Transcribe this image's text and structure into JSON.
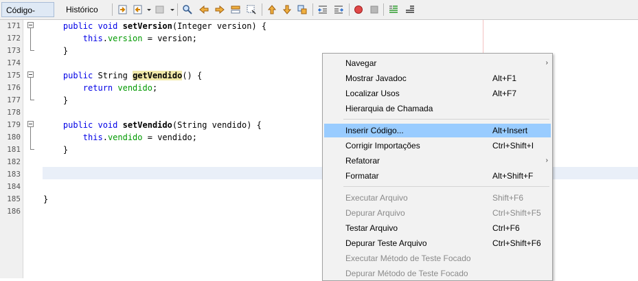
{
  "tabs": {
    "source": "Código-Fonte",
    "history": "Histórico"
  },
  "toolbar_icons": [
    "go-to-last-edit-icon",
    "back-icon",
    "forward-icon",
    "find-icon",
    "find-previous-icon",
    "find-next-icon",
    "find-selection-icon",
    "toggle-highlight-icon",
    "previous-bookmark-icon",
    "next-bookmark-icon",
    "toggle-bookmark-icon",
    "shift-left-icon",
    "shift-right-icon",
    "start-macro-icon",
    "stop-macro-icon",
    "comment-icon",
    "uncomment-icon"
  ],
  "editor": {
    "line_numbers": [
      "171",
      "172",
      "173",
      "174",
      "175",
      "176",
      "177",
      "178",
      "179",
      "180",
      "181",
      "182",
      "183",
      "184",
      "185",
      "186"
    ],
    "current_line": "183",
    "lines": {
      "l171": {
        "kw": "public void ",
        "method": "setVersion",
        "rest": "(Integer version) {"
      },
      "l172": {
        "kw": "this",
        "dot": ".",
        "field": "version",
        "rest": " = version;"
      },
      "l173": "}",
      "l175": {
        "kw": "public ",
        "type": "String ",
        "method": "getVendido",
        "rest": "() {"
      },
      "l176": {
        "kw": "return ",
        "field": "vendido",
        "rest": ";"
      },
      "l177": "}",
      "l179": {
        "kw": "public void ",
        "method": "setVendido",
        "rest": "(String vendido) {"
      },
      "l180": {
        "kw": "this",
        "dot": ".",
        "field": "vendido",
        "rest": " = vendido;"
      },
      "l181": "}",
      "l185": "}"
    }
  },
  "context_menu": {
    "items": [
      {
        "label": "Navegar",
        "shortcut": "",
        "submenu": true,
        "enabled": true
      },
      {
        "label": "Mostrar Javadoc",
        "shortcut": "Alt+F1",
        "enabled": true
      },
      {
        "label": "Localizar Usos",
        "shortcut": "Alt+F7",
        "enabled": true
      },
      {
        "label": "Hierarquia de Chamada",
        "shortcut": "",
        "enabled": true
      },
      {
        "label": "Inserir Código...",
        "shortcut": "Alt+Insert",
        "enabled": true,
        "selected": true
      },
      {
        "label": "Corrigir Importações",
        "shortcut": "Ctrl+Shift+I",
        "enabled": true
      },
      {
        "label": "Refatorar",
        "shortcut": "",
        "submenu": true,
        "enabled": true
      },
      {
        "label": "Formatar",
        "shortcut": "Alt+Shift+F",
        "enabled": true
      },
      {
        "label": "Executar Arquivo",
        "shortcut": "Shift+F6",
        "enabled": false
      },
      {
        "label": "Depurar Arquivo",
        "shortcut": "Ctrl+Shift+F5",
        "enabled": false
      },
      {
        "label": "Testar Arquivo",
        "shortcut": "Ctrl+F6",
        "enabled": true
      },
      {
        "label": "Depurar Teste Arquivo",
        "shortcut": "Ctrl+Shift+F6",
        "enabled": true
      },
      {
        "label": "Executar Método de Teste Focado",
        "shortcut": "",
        "enabled": false
      },
      {
        "label": "Depurar Método de Teste Focado",
        "shortcut": "",
        "enabled": false
      }
    ],
    "submenu_arrow": "›"
  },
  "colors": {
    "keyword": "#0000e6",
    "field": "#009900",
    "selection": "#99ccff",
    "highlight": "#f1e9a9",
    "current_line": "#e9eff8"
  }
}
